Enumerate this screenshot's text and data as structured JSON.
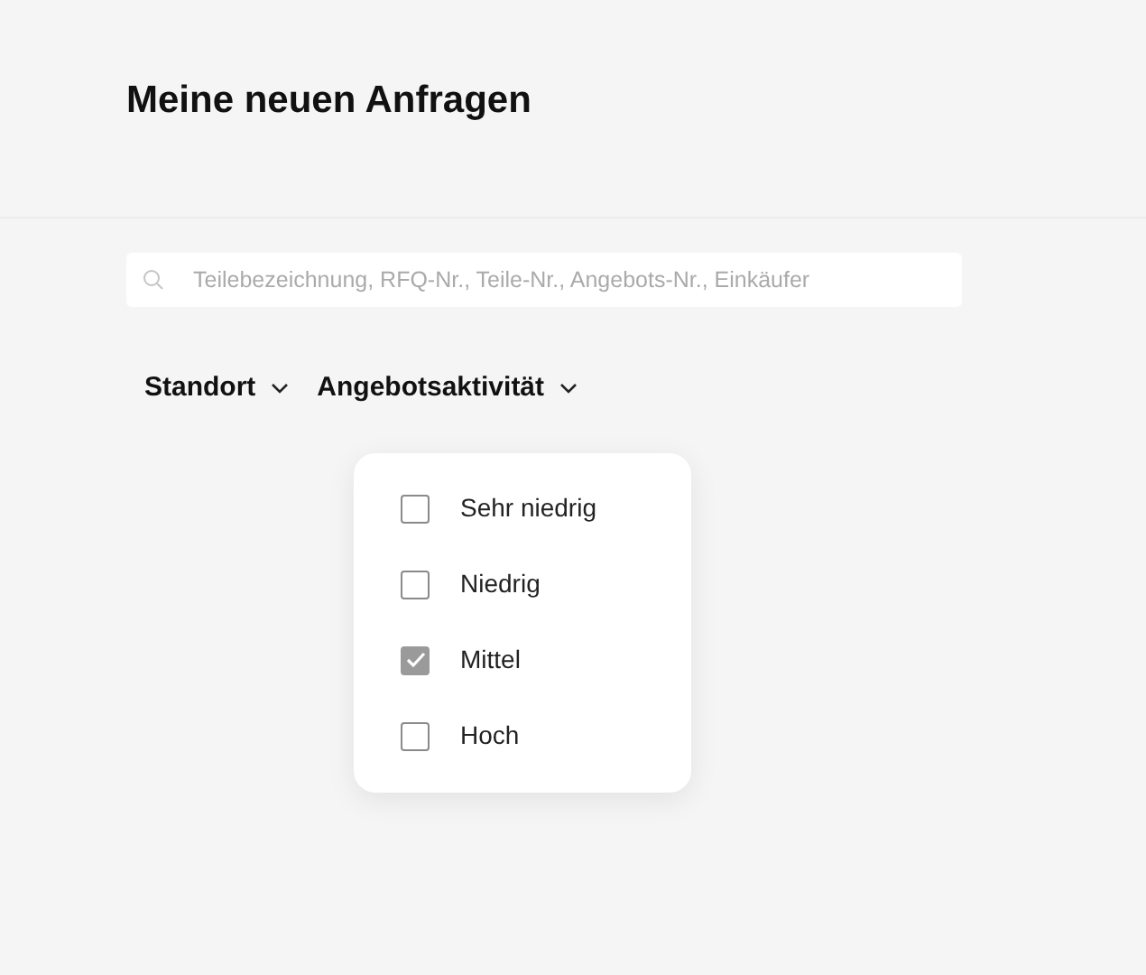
{
  "page": {
    "title": "Meine neuen Anfragen"
  },
  "search": {
    "placeholder": "Teilebezeichnung, RFQ-Nr., Teile-Nr., Angebots-Nr., Einkäufer"
  },
  "filters": [
    {
      "label": "Standort"
    },
    {
      "label": "Angebotsaktivität"
    }
  ],
  "dropdown": {
    "options": [
      {
        "label": "Sehr niedrig",
        "checked": false
      },
      {
        "label": "Niedrig",
        "checked": false
      },
      {
        "label": "Mittel",
        "checked": true
      },
      {
        "label": "Hoch",
        "checked": false
      }
    ]
  }
}
